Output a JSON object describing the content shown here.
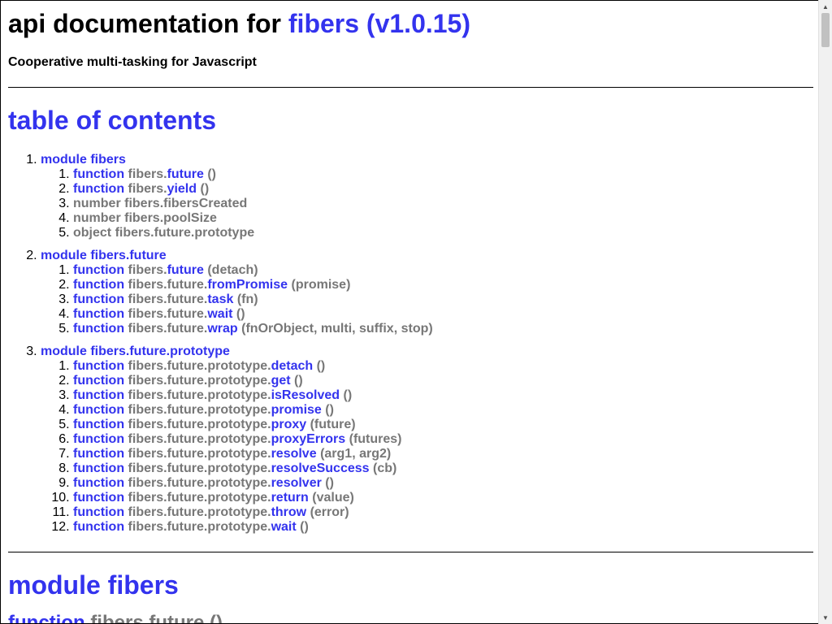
{
  "header": {
    "title_prefix": "api documentation for",
    "title_link": "fibers (v1.0.15)",
    "subtitle": "Cooperative multi-tasking for Javascript"
  },
  "toc": {
    "heading": "table of contents",
    "modules": [
      {
        "label": "module fibers",
        "items": [
          {
            "kind": "function",
            "prefix": "fibers.",
            "name": "future",
            "args": "()"
          },
          {
            "kind": "function",
            "prefix": "fibers.",
            "name": "yield",
            "args": "()"
          },
          {
            "kind": "",
            "prefix": "number fibers.fibersCreated",
            "name": "",
            "args": ""
          },
          {
            "kind": "",
            "prefix": "number fibers.poolSize",
            "name": "",
            "args": ""
          },
          {
            "kind": "",
            "prefix": "object fibers.future.prototype",
            "name": "",
            "args": ""
          }
        ]
      },
      {
        "label": "module fibers.future",
        "items": [
          {
            "kind": "function",
            "prefix": "fibers.",
            "name": "future",
            "args": "(detach)"
          },
          {
            "kind": "function",
            "prefix": "fibers.future.",
            "name": "fromPromise",
            "args": "(promise)"
          },
          {
            "kind": "function",
            "prefix": "fibers.future.",
            "name": "task",
            "args": "(fn)"
          },
          {
            "kind": "function",
            "prefix": "fibers.future.",
            "name": "wait",
            "args": "()"
          },
          {
            "kind": "function",
            "prefix": "fibers.future.",
            "name": "wrap",
            "args": "(fnOrObject, multi, suffix, stop)"
          }
        ]
      },
      {
        "label": "module fibers.future.prototype",
        "items": [
          {
            "kind": "function",
            "prefix": "fibers.future.prototype.",
            "name": "detach",
            "args": "()"
          },
          {
            "kind": "function",
            "prefix": "fibers.future.prototype.",
            "name": "get",
            "args": "()"
          },
          {
            "kind": "function",
            "prefix": "fibers.future.prototype.",
            "name": "isResolved",
            "args": "()"
          },
          {
            "kind": "function",
            "prefix": "fibers.future.prototype.",
            "name": "promise",
            "args": "()"
          },
          {
            "kind": "function",
            "prefix": "fibers.future.prototype.",
            "name": "proxy",
            "args": "(future)"
          },
          {
            "kind": "function",
            "prefix": "fibers.future.prototype.",
            "name": "proxyErrors",
            "args": "(futures)"
          },
          {
            "kind": "function",
            "prefix": "fibers.future.prototype.",
            "name": "resolve",
            "args": "(arg1, arg2)"
          },
          {
            "kind": "function",
            "prefix": "fibers.future.prototype.",
            "name": "resolveSuccess",
            "args": "(cb)"
          },
          {
            "kind": "function",
            "prefix": "fibers.future.prototype.",
            "name": "resolver",
            "args": "()"
          },
          {
            "kind": "function",
            "prefix": "fibers.future.prototype.",
            "name": "return",
            "args": "(value)"
          },
          {
            "kind": "function",
            "prefix": "fibers.future.prototype.",
            "name": "throw",
            "args": "(error)"
          },
          {
            "kind": "function",
            "prefix": "fibers.future.prototype.",
            "name": "wait",
            "args": "()"
          }
        ]
      }
    ]
  },
  "section": {
    "heading": "module fibers",
    "first_entry": {
      "kind": "function",
      "prefix": "fibers.",
      "name": "future",
      "args": "()"
    }
  },
  "scrollbar": {
    "up_icon": "arrow-up-icon",
    "down_icon": "arrow-down-icon",
    "position_fraction": 0.0
  },
  "colors": {
    "link": "#3333ee",
    "muted": "#777777",
    "text": "#000000"
  }
}
